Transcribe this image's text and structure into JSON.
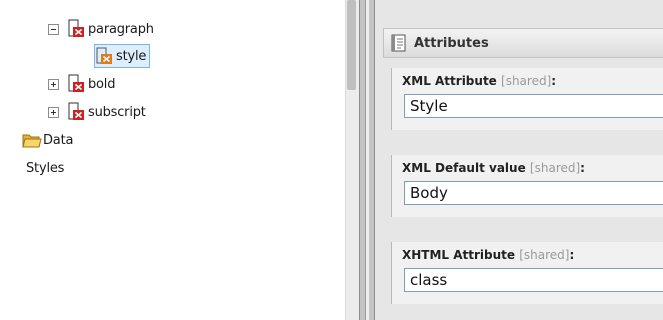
{
  "tree": {
    "items": [
      {
        "label": "paragraph",
        "expander": "minus",
        "icon": "element-icon"
      },
      {
        "label": "style",
        "icon": "attribute-icon",
        "selected": true
      },
      {
        "label": "bold",
        "expander": "plus",
        "icon": "element-icon"
      },
      {
        "label": "subscript",
        "expander": "plus",
        "icon": "element-icon"
      },
      {
        "label": "Data",
        "icon": "folder-icon"
      },
      {
        "label": "Styles"
      }
    ]
  },
  "attributes_panel": {
    "title": "Attributes",
    "icon": "document-icon",
    "fields": [
      {
        "label": "XML Attribute",
        "shared": "[shared]",
        "suffix": ":",
        "value": "Style"
      },
      {
        "label": "XML Default value",
        "shared": "[shared]",
        "suffix": ":",
        "value": "Body"
      },
      {
        "label": "XHTML Attribute",
        "shared": "[shared]",
        "suffix": ":",
        "value": "class"
      }
    ]
  },
  "colors": {
    "selection_bg": "#ddeeff",
    "selection_border": "#7fb2e6",
    "element_icon_red": "#cc2222",
    "attribute_icon_orange": "#e07a1a",
    "folder_yellow": "#f2c94c",
    "pane_bg": "#e6e6e6"
  }
}
